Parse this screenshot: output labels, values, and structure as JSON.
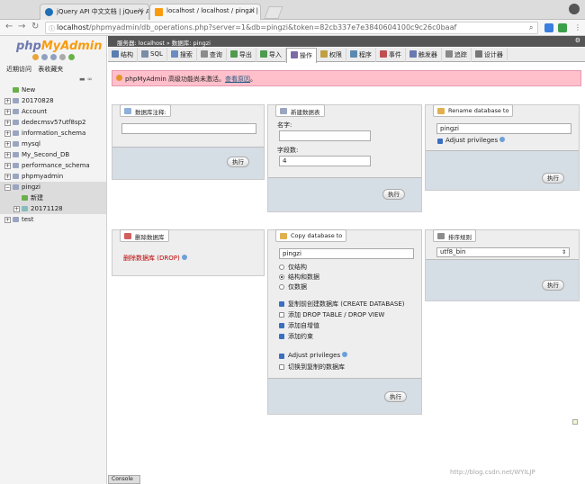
{
  "browser": {
    "tabs": [
      {
        "title": "jQuery API 中文文档 | jQuery AP",
        "active": false
      },
      {
        "title": "localhost / localhost / pingzi | p",
        "active": true
      }
    ],
    "url_host": "localhost",
    "url_path": "/phpmyadmin/db_operations.php?server=1&db=pingzi&token=82cb337e7e3840604100c9c26c0baaf"
  },
  "sidebar": {
    "logo_php": "php",
    "logo_myadmin": "MyAdmin",
    "links": [
      "近期访问",
      "表收藏夹"
    ],
    "new_label": "New",
    "databases": [
      {
        "name": "20170828"
      },
      {
        "name": "Account"
      },
      {
        "name": "dedecmsv57utf8sp2"
      },
      {
        "name": "information_schema"
      },
      {
        "name": "mysql"
      },
      {
        "name": "My_Second_DB"
      },
      {
        "name": "performance_schema"
      },
      {
        "name": "phpmyadmin"
      },
      {
        "name": "pingzi"
      },
      {
        "name": "test"
      }
    ],
    "pingzi_children": [
      "新建",
      "20171128"
    ],
    "console_label": "Console"
  },
  "breadcrumb": {
    "server_label": "服务器: localhost",
    "sep": "»",
    "db_label": "数据库: pingzi"
  },
  "menu": [
    {
      "label": "结构",
      "color": "#5a7db0",
      "active": false
    },
    {
      "label": "SQL",
      "color": "#7a8ca6",
      "active": false
    },
    {
      "label": "搜索",
      "color": "#6a8cc0",
      "active": false
    },
    {
      "label": "查询",
      "color": "#8c8c8c",
      "active": false
    },
    {
      "label": "导出",
      "color": "#4e9a4e",
      "active": false
    },
    {
      "label": "导入",
      "color": "#4e9a4e",
      "active": false
    },
    {
      "label": "操作",
      "color": "#7c6aa6",
      "active": true
    },
    {
      "label": "权限",
      "color": "#c0a040",
      "active": false
    },
    {
      "label": "程序",
      "color": "#5a8ab0",
      "active": false
    },
    {
      "label": "事件",
      "color": "#c05050",
      "active": false
    },
    {
      "label": "触发器",
      "color": "#6a7ab0",
      "active": false
    },
    {
      "label": "追踪",
      "color": "#888888",
      "active": false
    },
    {
      "label": "设计器",
      "color": "#777777",
      "active": false
    }
  ],
  "notice": {
    "text": "phpMyAdmin 高级功能尚未激活。",
    "link": "查看原因",
    "suffix": "。"
  },
  "panels": {
    "comment": {
      "title": "数据库注释:",
      "value": "",
      "go": "执行"
    },
    "create_table": {
      "title": "新建数据表",
      "name_label": "名字:",
      "name_value": "",
      "cols_label": "字段数:",
      "cols_value": "4",
      "go": "执行"
    },
    "rename": {
      "title": "Rename database to",
      "value": "pingzi",
      "adjust": "Adjust privileges",
      "go": "执行"
    },
    "drop": {
      "title": "删除数据库",
      "link": "删除数据库 (DROP)"
    },
    "copy": {
      "title": "Copy database to",
      "value": "pingzi",
      "radios": [
        "仅结构",
        "结构和数据",
        "仅数据"
      ],
      "checks": [
        "复制前创建数据库 (CREATE DATABASE)",
        "添加 DROP TABLE / DROP VIEW",
        "添加自增值",
        "添加约束"
      ],
      "adjust": "Adjust privileges",
      "switch": "切换到复制的数据库",
      "go": "执行"
    },
    "collation": {
      "title": "排序规则",
      "value": "utf8_bin",
      "go": "执行"
    }
  },
  "watermark": "http://blog.csdn.net/WYILJP"
}
